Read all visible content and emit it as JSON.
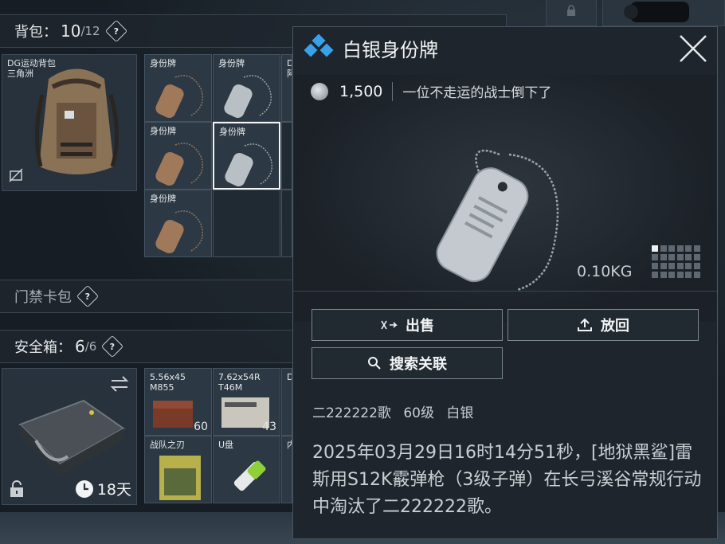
{
  "backpack": {
    "title": "背包：",
    "count": "10",
    "max": "/12",
    "help": "?",
    "container_name": "DG运动背包\n三角洲",
    "items": [
      {
        "label": "身份牌",
        "tone": "bronze"
      },
      {
        "label": "身份牌",
        "tone": "silver"
      },
      {
        "label": "D\n阿",
        "tone": "none"
      },
      {
        "label": "身份牌",
        "tone": "bronze"
      },
      {
        "label": "身份牌",
        "tone": "silver",
        "selected": true
      },
      {
        "label": "身份牌",
        "tone": "bronze"
      }
    ]
  },
  "keycard": {
    "title": "门禁卡包",
    "help": "?"
  },
  "safe": {
    "title": "安全箱：",
    "count": "6",
    "max": "/6",
    "help": "?",
    "days": "18天",
    "items": [
      {
        "label": "5.56x45\nM855",
        "count": "60"
      },
      {
        "label": "7.62x54R\nT46M",
        "count": "43"
      },
      {
        "label": "D",
        "count": ""
      },
      {
        "label": "战队之刃",
        "count": ""
      },
      {
        "label": "U盘",
        "count": ""
      },
      {
        "label": "内",
        "count": ""
      }
    ]
  },
  "popup": {
    "title": "白银身份牌",
    "price": "1,500",
    "flavor": "一位不走运的战士倒下了",
    "weight": "0.10KG",
    "buttons": {
      "sell": "出售",
      "return": "放回",
      "search": "搜索关联"
    },
    "owner": {
      "name": "二222222歌",
      "level": "60级",
      "rank": "白银"
    },
    "story": "2025年03月29日16时14分51秒，[地狱黑鲨]雷斯用S12K霰弹枪（3级子弹）在长弓溪谷常规行动中淘汰了二222222歌。"
  },
  "colors": {
    "accent": "#3aa0e8",
    "bg": "#1e252c"
  }
}
